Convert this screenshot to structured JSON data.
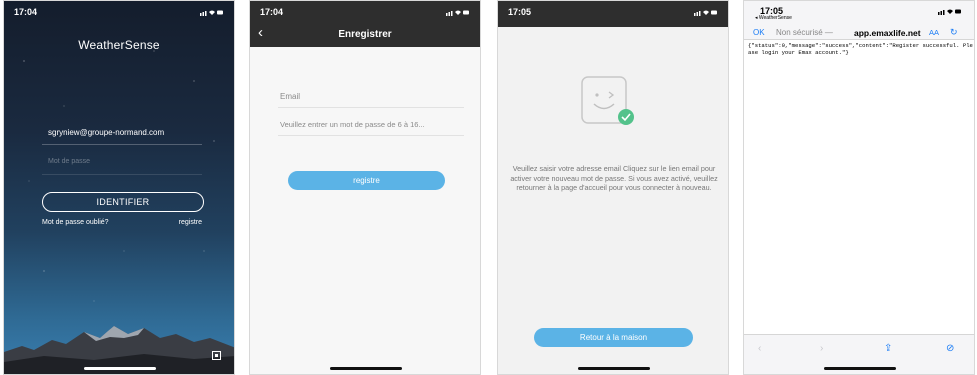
{
  "screen1": {
    "time": "17:04",
    "app_title": "WeatherSense",
    "email_value": "sgryniew@groupe-normand.com",
    "password_placeholder": "Mot de passe",
    "login_label": "IDENTIFIER",
    "forgot_label": "Mot de passe oublié?",
    "register_label": "registre"
  },
  "screen2": {
    "time": "17:04",
    "title": "Enregistrer",
    "email_placeholder": "Email",
    "password_placeholder": "Veuillez entrer un mot de passe de 6 à 16...",
    "register_button": "registre"
  },
  "screen3": {
    "time": "17:05",
    "message": "Veuillez saisir votre adresse email Cliquez sur le lien email pour activer votre nouveau mot de passe. Si vous avez activé, veuillez retourner à la page d'accueil pour vous connecter à nouveau.",
    "home_button": "Retour à la maison"
  },
  "screen4": {
    "time": "17:05",
    "back_app": "◂ WeatherSense",
    "ok_label": "OK",
    "insecure_label": "Non sécurisé —",
    "domain": "app.emaxlife.net",
    "aa_label": "AA",
    "json_text": "{\"status\":0,\"message\":\"success\",\"content\":\"Register successful. Please login your Emax account.\"}"
  },
  "colors": {
    "accent_blue": "#5bb3e6",
    "safari_blue": "#1a7cf5",
    "dark_bar": "#2e2e2e"
  }
}
